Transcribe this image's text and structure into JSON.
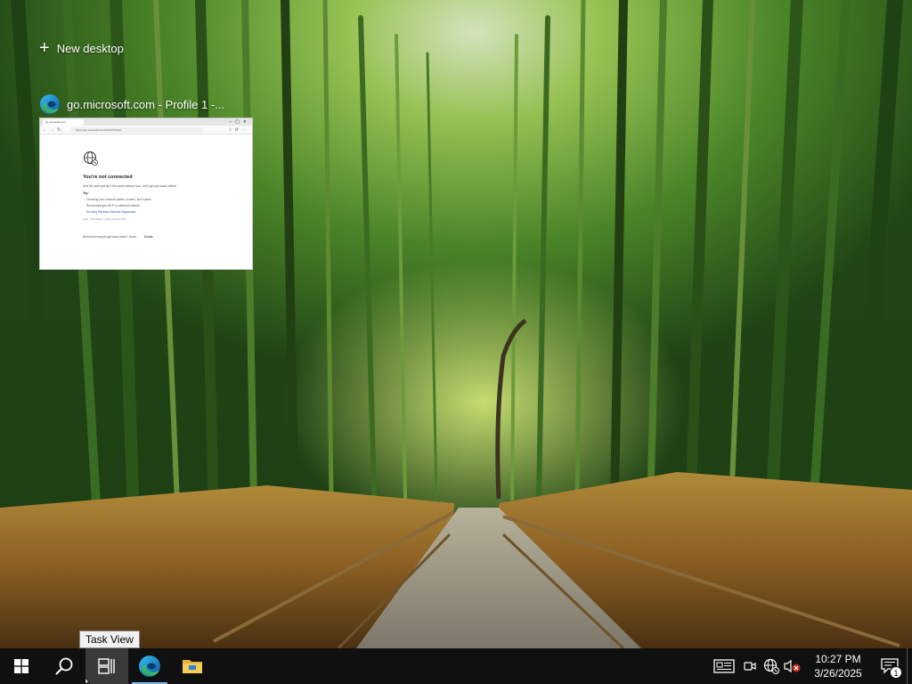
{
  "task_view": {
    "new_desktop_label": "New desktop",
    "new_desktop_icon": "plus-icon"
  },
  "window": {
    "title": "go.microsoft.com - Profile 1 -...",
    "app_icon": "edge-icon",
    "thumbnail": {
      "tab_label": "go.microsoft.com",
      "url": "https://go.microsoft.com/fwlink/?linkid=",
      "heading": "You're not connected",
      "message": "And the web just isn't the same without you. Let's get you back online!",
      "try_label": "Try:",
      "bullets": [
        "Checking your network cables, modem, and routers",
        "Reconnecting to Wi-Fi or ethernet network",
        "Running Windows Network Diagnostics"
      ],
      "error_code": "ERR_INTERNET_DISCONNECTED",
      "footer_text": "Need help trying to get back online? Hover.",
      "details_label": "Details"
    }
  },
  "tooltip": {
    "text": "Task View"
  },
  "taskbar": {
    "buttons": [
      {
        "name": "start-button",
        "icon": "windows-logo-icon"
      },
      {
        "name": "search-button",
        "icon": "search-icon"
      },
      {
        "name": "task-view-button",
        "icon": "task-view-icon"
      },
      {
        "name": "edge-taskbar-button",
        "icon": "edge-icon"
      },
      {
        "name": "file-explorer-button",
        "icon": "folder-icon"
      }
    ],
    "tray": {
      "icons": [
        "news-icon",
        "meet-now-icon",
        "network-disconnected-icon",
        "volume-muted-icon"
      ],
      "time": "10:27 PM",
      "date": "3/26/2025",
      "notification_count": "1"
    }
  },
  "colors": {
    "taskbar_bg": "#101010",
    "active_button_bg": "#3a3a3a",
    "running_indicator": "#76b9ed"
  }
}
